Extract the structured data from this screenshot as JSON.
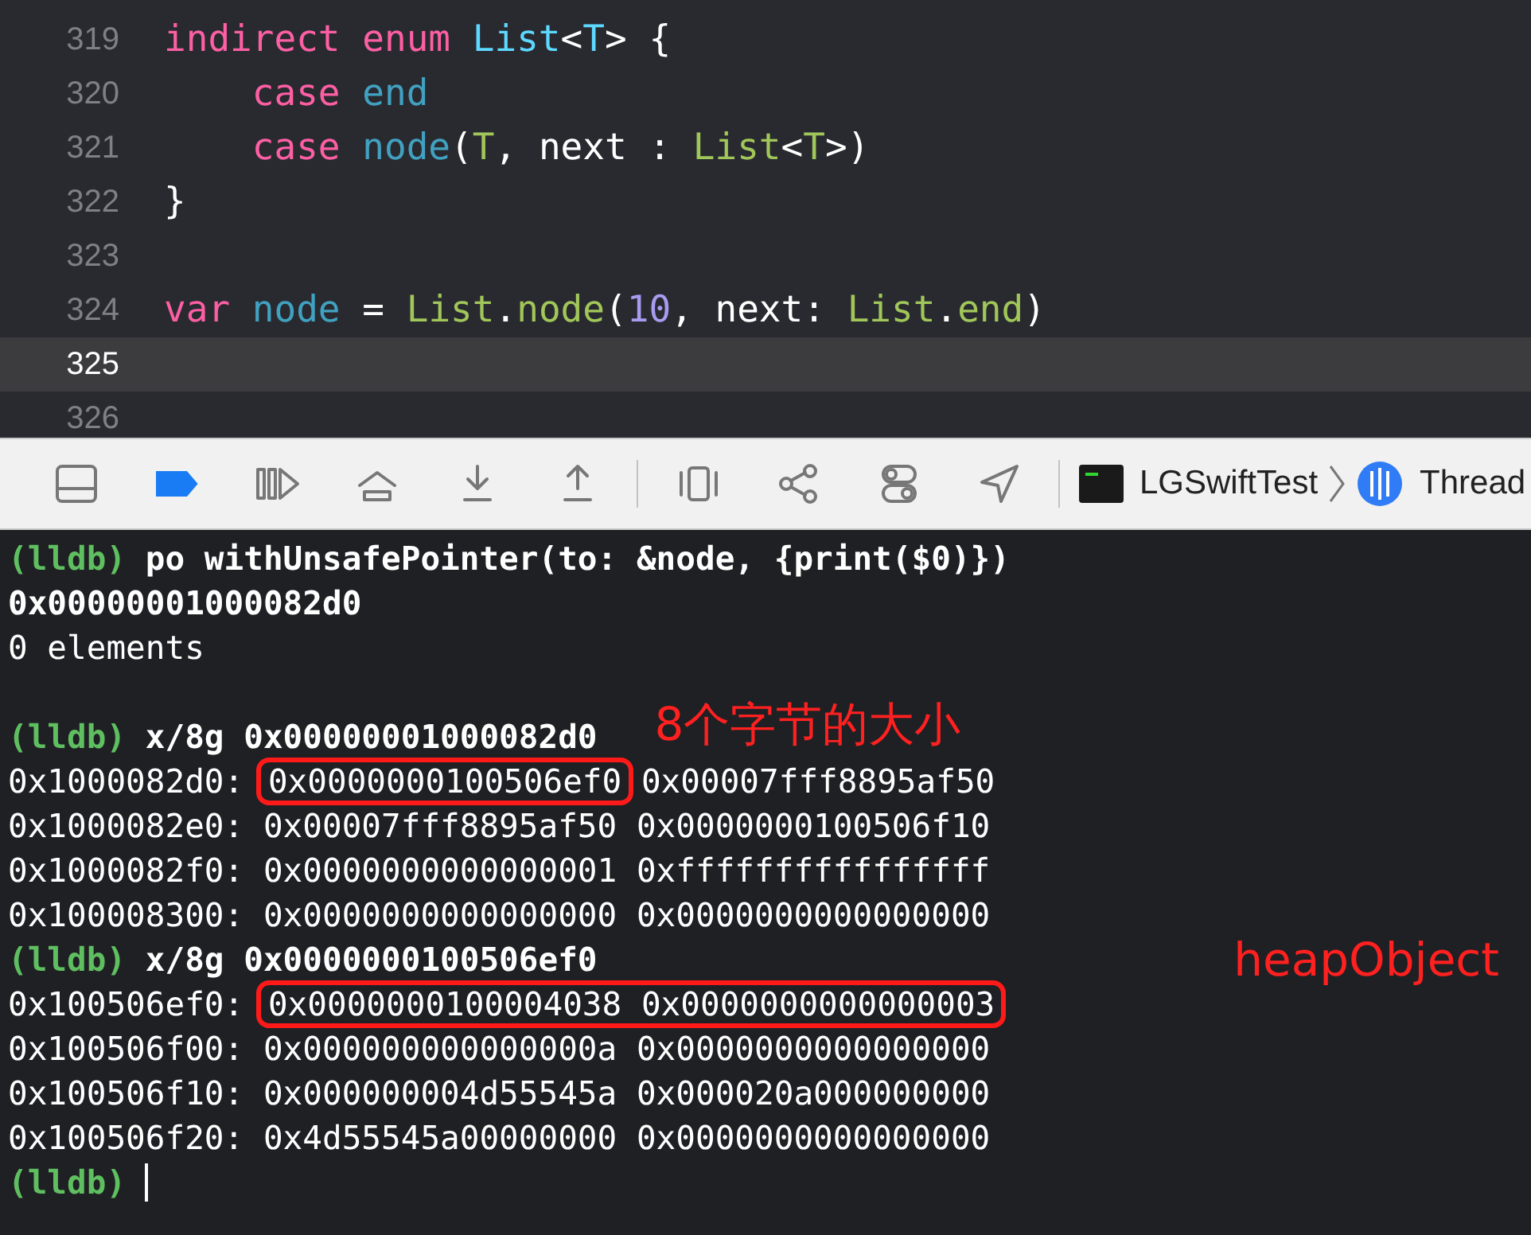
{
  "editor": {
    "lines": [
      {
        "number": "319",
        "current": false,
        "tokens": [
          {
            "text": "indirect",
            "kind": "keyword"
          },
          {
            "text": " enum",
            "kind": "keyword"
          },
          {
            "text": " List",
            "kind": "decl_type"
          },
          {
            "text": "<",
            "kind": "plain"
          },
          {
            "text": "T",
            "kind": "decl_type"
          },
          {
            "text": "> {",
            "kind": "plain"
          }
        ]
      },
      {
        "number": "320",
        "current": false,
        "tokens": [
          {
            "text": "    case",
            "kind": "keyword"
          },
          {
            "text": " end",
            "kind": "decl"
          }
        ]
      },
      {
        "number": "321",
        "current": false,
        "tokens": [
          {
            "text": "    case",
            "kind": "keyword"
          },
          {
            "text": " node",
            "kind": "decl"
          },
          {
            "text": "(",
            "kind": "plain"
          },
          {
            "text": "T",
            "kind": "type_ref"
          },
          {
            "text": ", next : ",
            "kind": "plain"
          },
          {
            "text": "List",
            "kind": "type_ref"
          },
          {
            "text": "<",
            "kind": "plain"
          },
          {
            "text": "T",
            "kind": "type_ref"
          },
          {
            "text": ">)",
            "kind": "plain"
          }
        ]
      },
      {
        "number": "322",
        "current": false,
        "tokens": [
          {
            "text": "}",
            "kind": "plain"
          }
        ]
      },
      {
        "number": "323",
        "current": false
      },
      {
        "number": "324",
        "current": false,
        "tokens": [
          {
            "text": "var",
            "kind": "keyword"
          },
          {
            "text": " node",
            "kind": "decl"
          },
          {
            "text": " = ",
            "kind": "plain"
          },
          {
            "text": "List",
            "kind": "type_ref"
          },
          {
            "text": ".",
            "kind": "plain"
          },
          {
            "text": "node",
            "kind": "type_ref"
          },
          {
            "text": "(",
            "kind": "plain"
          },
          {
            "text": "10",
            "kind": "number"
          },
          {
            "text": ", next: ",
            "kind": "plain"
          },
          {
            "text": "List",
            "kind": "type_ref"
          },
          {
            "text": ".",
            "kind": "plain"
          },
          {
            "text": "end",
            "kind": "type_ref"
          },
          {
            "text": ")",
            "kind": "plain"
          }
        ]
      },
      {
        "number": "325",
        "current": true
      },
      {
        "number": "326",
        "current": false
      }
    ]
  },
  "toolbar": {
    "buttons": [
      {
        "kind": "panel",
        "active": false
      },
      {
        "kind": "breakpoints",
        "active": true
      },
      {
        "kind": "continue",
        "active": false
      },
      {
        "kind": "step_over",
        "active": false
      },
      {
        "kind": "step_into",
        "active": false
      },
      {
        "kind": "step_out",
        "active": false
      },
      {
        "kind": "view_debugger",
        "active": false
      },
      {
        "kind": "memory_graph",
        "active": false
      },
      {
        "kind": "environment",
        "active": false
      },
      {
        "kind": "location",
        "active": false
      }
    ],
    "breadcrumb": [
      {
        "kind": "app",
        "label": "LGSwiftTest"
      },
      {
        "kind": "thread",
        "label": "Thread"
      }
    ]
  },
  "console": {
    "lines": [
      {
        "kind": "command",
        "prompt": "(lldb)",
        "text": "po withUnsafePointer(to: &node, {print($0)})"
      },
      {
        "kind": "output",
        "text": "0x00000001000082d0",
        "bold": true
      },
      {
        "kind": "output",
        "text": "0 elements",
        "bold": false
      },
      {
        "kind": "blank"
      },
      {
        "kind": "command",
        "prompt": "(lldb)",
        "text": "x/8g 0x00000001000082d0",
        "annotation": "8个字节的大小"
      },
      {
        "kind": "memory",
        "address": "0x1000082d0:",
        "values": [
          {
            "text": "0x0000000100506ef0",
            "boxed": true
          },
          {
            "text": "0x00007fff8895af50",
            "boxed": false
          }
        ]
      },
      {
        "kind": "memory",
        "address": "0x1000082e0:",
        "values": [
          {
            "text": "0x00007fff8895af50",
            "boxed": false
          },
          {
            "text": "0x0000000100506f10",
            "boxed": false
          }
        ]
      },
      {
        "kind": "memory",
        "address": "0x1000082f0:",
        "values": [
          {
            "text": "0x0000000000000001",
            "boxed": false
          },
          {
            "text": "0xffffffffffffffff",
            "boxed": false
          }
        ]
      },
      {
        "kind": "memory",
        "address": "0x100008300:",
        "values": [
          {
            "text": "0x0000000000000000",
            "boxed": false
          },
          {
            "text": "0x0000000000000000",
            "boxed": false
          }
        ]
      },
      {
        "kind": "command",
        "prompt": "(lldb)",
        "text": "x/8g 0x0000000100506ef0",
        "annotation": "heapObject"
      },
      {
        "kind": "memory",
        "address": "0x100506ef0:",
        "values": [
          {
            "text": "0x0000000100004038",
            "boxed": true
          },
          {
            "text": "0x0000000000000003",
            "boxed": true
          }
        ]
      },
      {
        "kind": "memory",
        "address": "0x100506f00:",
        "values": [
          {
            "text": "0x000000000000000a",
            "boxed": false
          },
          {
            "text": "0x0000000000000000",
            "boxed": false
          }
        ]
      },
      {
        "kind": "memory",
        "address": "0x100506f10:",
        "values": [
          {
            "text": "0x000000004d55545a",
            "boxed": false
          },
          {
            "text": "0x000020a000000000",
            "boxed": false
          }
        ]
      },
      {
        "kind": "memory",
        "address": "0x100506f20:",
        "values": [
          {
            "text": "0x4d55545a00000000",
            "boxed": false
          },
          {
            "text": "0x0000000000000000",
            "boxed": false
          }
        ]
      },
      {
        "kind": "prompt",
        "prompt": "(lldb)",
        "cursor": true
      }
    ]
  }
}
